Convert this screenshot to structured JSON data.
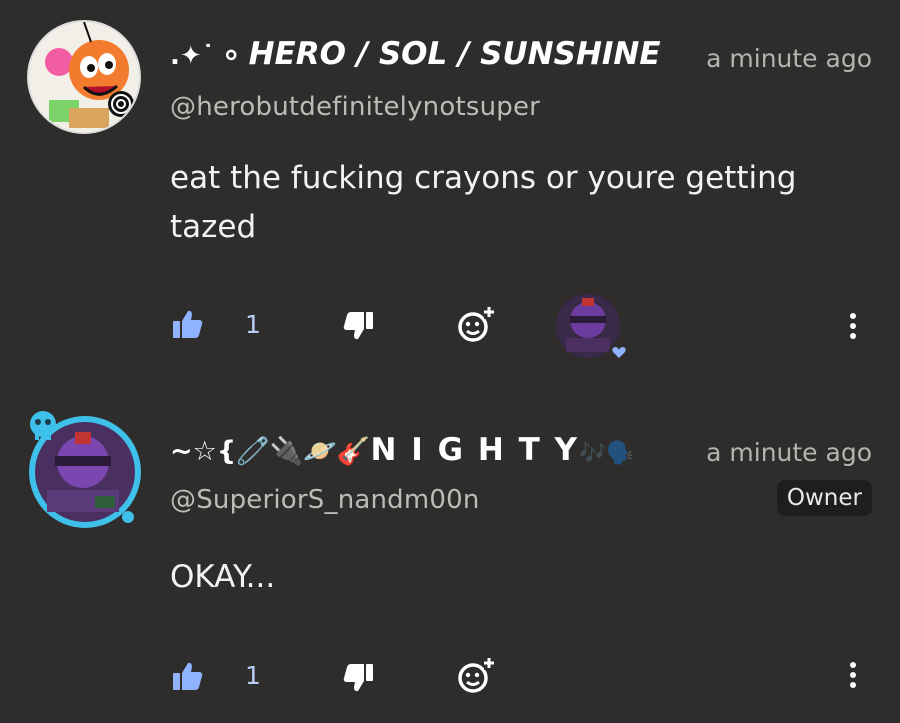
{
  "comments": [
    {
      "display_name": "HERO / SOL / SUNSHINE",
      "name_prefix": ".✦˙ ⸰",
      "time": "a minute ago",
      "handle": "@herobutdefinitelynotsuper",
      "text": "eat the fucking crayons or youre getting tazed",
      "like_count": "1",
      "owner_badge": null
    },
    {
      "display_name": "N I G H T Y",
      "name_prefix": "~☆{🧷🔌🪐🎸",
      "name_suffix": "🎶🗣️",
      "time": "a minute ago",
      "handle": "@SuperiorS_nandm00n",
      "text": "OKAY...",
      "like_count": "1",
      "owner_badge": "Owner"
    }
  ],
  "colors": {
    "background": "#2e2d2b",
    "like_accent": "#8fb3ff",
    "heart_badge": "#8fb3ff",
    "avatar_ring": "#3fc0ea"
  },
  "icons": [
    "thumbs-up-icon",
    "thumbs-down-icon",
    "add-reaction-icon",
    "more-vert-icon",
    "heart-icon"
  ]
}
